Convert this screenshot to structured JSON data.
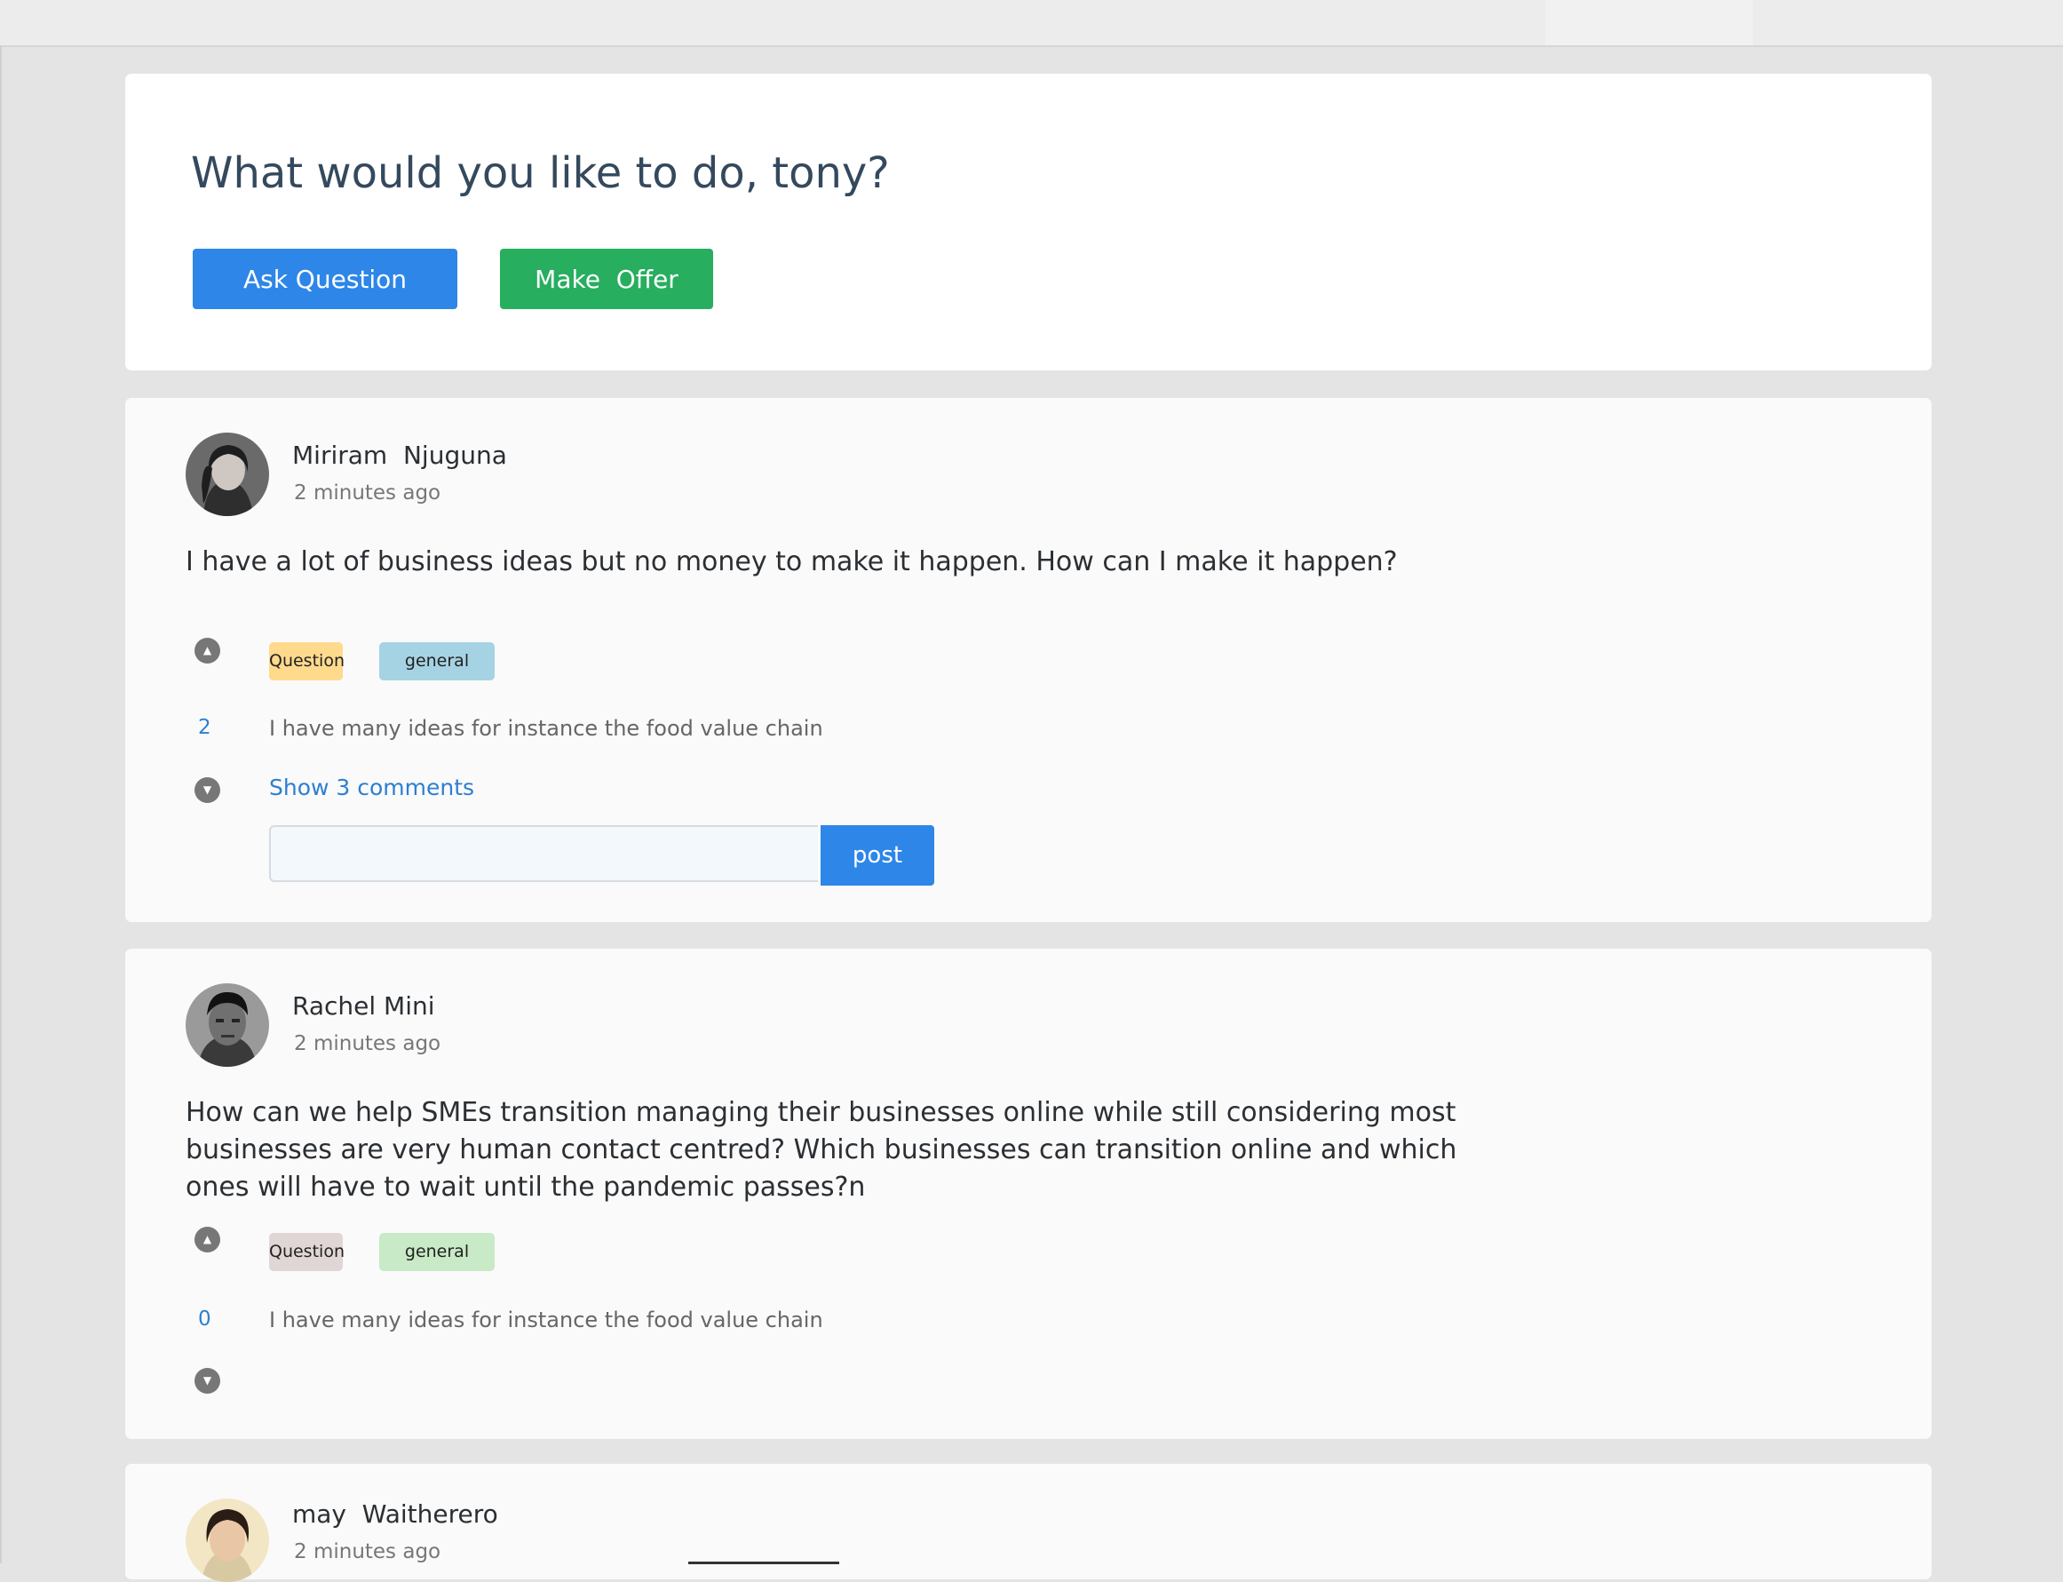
{
  "welcome": {
    "title": "What would you like to do, tony?",
    "ask_label": "Ask Question",
    "offer_label": "Make  Offer"
  },
  "posts": [
    {
      "author": "Miriram  Njuguna",
      "time": "2 minutes ago",
      "text": "I have a lot of business ideas but no money to make it happen. How can I make it happen?",
      "tags": [
        "Question",
        "general"
      ],
      "votes": "2",
      "answer": "I have many ideas for instance the food value chain",
      "show_comments": "Show 3 comments",
      "post_label": "post"
    },
    {
      "author": "Rachel Mini",
      "time": "2 minutes ago",
      "text": "How can we help SMEs transition managing their businesses online while still considering most businesses are very human contact centred? Which businesses can transition online and which ones will have to wait until the pandemic passes?n",
      "tags": [
        "Question",
        "general"
      ],
      "votes": "0",
      "answer": "I have many ideas for instance the food value chain"
    },
    {
      "author": "may  Waitherero",
      "time": "2 minutes ago"
    }
  ],
  "icons": {
    "upvote": "upvote-icon",
    "downvote": "downvote-icon"
  },
  "colors": {
    "primary": "#2d86e8",
    "success": "#27ae5f",
    "link": "#2d7fd1",
    "tag_yellow": "#ffd98c",
    "tag_blue": "#a6d3e4",
    "tag_grey": "#e1d6d6",
    "tag_green": "#c8eac6"
  }
}
